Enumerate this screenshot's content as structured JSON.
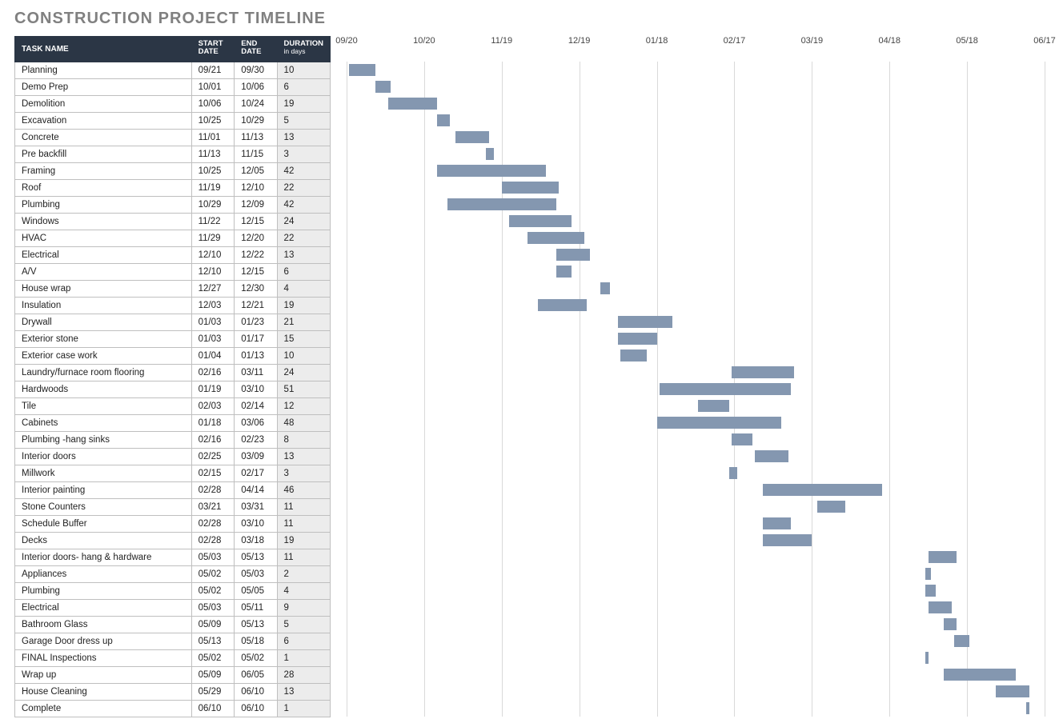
{
  "title": "CONSTRUCTION PROJECT TIMELINE",
  "columns": {
    "task": "TASK NAME",
    "start": "START DATE",
    "end": "END DATE",
    "duration": "DURATION",
    "duration_sub": "in days"
  },
  "timeline": {
    "start_day": 0,
    "end_day": 270,
    "ticks": [
      {
        "label": "09/20",
        "day": 0
      },
      {
        "label": "10/20",
        "day": 30
      },
      {
        "label": "11/19",
        "day": 60
      },
      {
        "label": "12/19",
        "day": 90
      },
      {
        "label": "01/18",
        "day": 120
      },
      {
        "label": "02/17",
        "day": 150
      },
      {
        "label": "03/19",
        "day": 180
      },
      {
        "label": "04/18",
        "day": 210
      },
      {
        "label": "05/18",
        "day": 240
      },
      {
        "label": "06/17",
        "day": 270
      }
    ]
  },
  "tasks": [
    {
      "name": "Planning",
      "start": "09/21",
      "end": "09/30",
      "duration": "10",
      "bar_start": 1,
      "bar_len": 10
    },
    {
      "name": "Demo Prep",
      "start": "10/01",
      "end": "10/06",
      "duration": "6",
      "bar_start": 11,
      "bar_len": 6
    },
    {
      "name": "Demolition",
      "start": "10/06",
      "end": "10/24",
      "duration": "19",
      "bar_start": 16,
      "bar_len": 19
    },
    {
      "name": "Excavation",
      "start": "10/25",
      "end": "10/29",
      "duration": "5",
      "bar_start": 35,
      "bar_len": 5
    },
    {
      "name": "Concrete",
      "start": "11/01",
      "end": "11/13",
      "duration": "13",
      "bar_start": 42,
      "bar_len": 13
    },
    {
      "name": "Pre backfill",
      "start": "11/13",
      "end": "11/15",
      "duration": "3",
      "bar_start": 54,
      "bar_len": 3
    },
    {
      "name": "Framing",
      "start": "10/25",
      "end": "12/05",
      "duration": "42",
      "bar_start": 35,
      "bar_len": 42
    },
    {
      "name": "Roof",
      "start": "11/19",
      "end": "12/10",
      "duration": "22",
      "bar_start": 60,
      "bar_len": 22
    },
    {
      "name": "Plumbing",
      "start": "10/29",
      "end": "12/09",
      "duration": "42",
      "bar_start": 39,
      "bar_len": 42
    },
    {
      "name": "Windows",
      "start": "11/22",
      "end": "12/15",
      "duration": "24",
      "bar_start": 63,
      "bar_len": 24
    },
    {
      "name": "HVAC",
      "start": "11/29",
      "end": "12/20",
      "duration": "22",
      "bar_start": 70,
      "bar_len": 22
    },
    {
      "name": "Electrical",
      "start": "12/10",
      "end": "12/22",
      "duration": "13",
      "bar_start": 81,
      "bar_len": 13
    },
    {
      "name": "A/V",
      "start": "12/10",
      "end": "12/15",
      "duration": "6",
      "bar_start": 81,
      "bar_len": 6
    },
    {
      "name": "House wrap",
      "start": "12/27",
      "end": "12/30",
      "duration": "4",
      "bar_start": 98,
      "bar_len": 4
    },
    {
      "name": "Insulation",
      "start": "12/03",
      "end": "12/21",
      "duration": "19",
      "bar_start": 74,
      "bar_len": 19
    },
    {
      "name": "Drywall",
      "start": "01/03",
      "end": "01/23",
      "duration": "21",
      "bar_start": 105,
      "bar_len": 21
    },
    {
      "name": "Exterior stone",
      "start": "01/03",
      "end": "01/17",
      "duration": "15",
      "bar_start": 105,
      "bar_len": 15
    },
    {
      "name": "Exterior case work",
      "start": "01/04",
      "end": "01/13",
      "duration": "10",
      "bar_start": 106,
      "bar_len": 10
    },
    {
      "name": "Laundry/furnace room flooring",
      "start": "02/16",
      "end": "03/11",
      "duration": "24",
      "bar_start": 149,
      "bar_len": 24
    },
    {
      "name": "Hardwoods",
      "start": "01/19",
      "end": "03/10",
      "duration": "51",
      "bar_start": 121,
      "bar_len": 51
    },
    {
      "name": "Tile",
      "start": "02/03",
      "end": "02/14",
      "duration": "12",
      "bar_start": 136,
      "bar_len": 12
    },
    {
      "name": "Cabinets",
      "start": "01/18",
      "end": "03/06",
      "duration": "48",
      "bar_start": 120,
      "bar_len": 48
    },
    {
      "name": "Plumbing -hang sinks",
      "start": "02/16",
      "end": "02/23",
      "duration": "8",
      "bar_start": 149,
      "bar_len": 8
    },
    {
      "name": "Interior doors",
      "start": "02/25",
      "end": "03/09",
      "duration": "13",
      "bar_start": 158,
      "bar_len": 13
    },
    {
      "name": "Millwork",
      "start": "02/15",
      "end": "02/17",
      "duration": "3",
      "bar_start": 148,
      "bar_len": 3
    },
    {
      "name": "Interior painting",
      "start": "02/28",
      "end": "04/14",
      "duration": "46",
      "bar_start": 161,
      "bar_len": 46
    },
    {
      "name": "Stone Counters",
      "start": "03/21",
      "end": "03/31",
      "duration": "11",
      "bar_start": 182,
      "bar_len": 11
    },
    {
      "name": "Schedule Buffer",
      "start": "02/28",
      "end": "03/10",
      "duration": "11",
      "bar_start": 161,
      "bar_len": 11
    },
    {
      "name": "Decks",
      "start": "02/28",
      "end": "03/18",
      "duration": "19",
      "bar_start": 161,
      "bar_len": 19
    },
    {
      "name": "Interior doors- hang & hardware",
      "start": "05/03",
      "end": "05/13",
      "duration": "11",
      "bar_start": 225,
      "bar_len": 11
    },
    {
      "name": "Appliances",
      "start": "05/02",
      "end": "05/03",
      "duration": "2",
      "bar_start": 224,
      "bar_len": 2
    },
    {
      "name": "Plumbing",
      "start": "05/02",
      "end": "05/05",
      "duration": "4",
      "bar_start": 224,
      "bar_len": 4
    },
    {
      "name": "Electrical",
      "start": "05/03",
      "end": "05/11",
      "duration": "9",
      "bar_start": 225,
      "bar_len": 9
    },
    {
      "name": "Bathroom Glass",
      "start": "05/09",
      "end": "05/13",
      "duration": "5",
      "bar_start": 231,
      "bar_len": 5
    },
    {
      "name": "Garage Door dress up",
      "start": "05/13",
      "end": "05/18",
      "duration": "6",
      "bar_start": 235,
      "bar_len": 6
    },
    {
      "name": "FINAL Inspections",
      "start": "05/02",
      "end": "05/02",
      "duration": "1",
      "bar_start": 224,
      "bar_len": 1
    },
    {
      "name": "Wrap up",
      "start": "05/09",
      "end": "06/05",
      "duration": "28",
      "bar_start": 231,
      "bar_len": 28
    },
    {
      "name": "House Cleaning",
      "start": "05/29",
      "end": "06/10",
      "duration": "13",
      "bar_start": 251,
      "bar_len": 13
    },
    {
      "name": "Complete",
      "start": "06/10",
      "end": "06/10",
      "duration": "1",
      "bar_start": 263,
      "bar_len": 1
    }
  ],
  "chart_data": {
    "type": "bar",
    "title": "CONSTRUCTION PROJECT TIMELINE",
    "xlabel": "",
    "ylabel": "",
    "x_axis_ticks": [
      "09/20",
      "10/20",
      "11/19",
      "12/19",
      "01/18",
      "02/17",
      "03/19",
      "04/18",
      "05/18",
      "06/17"
    ],
    "x_range_days": [
      0,
      270
    ],
    "series": [
      {
        "name": "Planning",
        "start_day": 1,
        "duration_days": 10
      },
      {
        "name": "Demo Prep",
        "start_day": 11,
        "duration_days": 6
      },
      {
        "name": "Demolition",
        "start_day": 16,
        "duration_days": 19
      },
      {
        "name": "Excavation",
        "start_day": 35,
        "duration_days": 5
      },
      {
        "name": "Concrete",
        "start_day": 42,
        "duration_days": 13
      },
      {
        "name": "Pre backfill",
        "start_day": 54,
        "duration_days": 3
      },
      {
        "name": "Framing",
        "start_day": 35,
        "duration_days": 42
      },
      {
        "name": "Roof",
        "start_day": 60,
        "duration_days": 22
      },
      {
        "name": "Plumbing",
        "start_day": 39,
        "duration_days": 42
      },
      {
        "name": "Windows",
        "start_day": 63,
        "duration_days": 24
      },
      {
        "name": "HVAC",
        "start_day": 70,
        "duration_days": 22
      },
      {
        "name": "Electrical",
        "start_day": 81,
        "duration_days": 13
      },
      {
        "name": "A/V",
        "start_day": 81,
        "duration_days": 6
      },
      {
        "name": "House wrap",
        "start_day": 98,
        "duration_days": 4
      },
      {
        "name": "Insulation",
        "start_day": 74,
        "duration_days": 19
      },
      {
        "name": "Drywall",
        "start_day": 105,
        "duration_days": 21
      },
      {
        "name": "Exterior stone",
        "start_day": 105,
        "duration_days": 15
      },
      {
        "name": "Exterior case work",
        "start_day": 106,
        "duration_days": 10
      },
      {
        "name": "Laundry/furnace room flooring",
        "start_day": 149,
        "duration_days": 24
      },
      {
        "name": "Hardwoods",
        "start_day": 121,
        "duration_days": 51
      },
      {
        "name": "Tile",
        "start_day": 136,
        "duration_days": 12
      },
      {
        "name": "Cabinets",
        "start_day": 120,
        "duration_days": 48
      },
      {
        "name": "Plumbing -hang sinks",
        "start_day": 149,
        "duration_days": 8
      },
      {
        "name": "Interior doors",
        "start_day": 158,
        "duration_days": 13
      },
      {
        "name": "Millwork",
        "start_day": 148,
        "duration_days": 3
      },
      {
        "name": "Interior painting",
        "start_day": 161,
        "duration_days": 46
      },
      {
        "name": "Stone Counters",
        "start_day": 182,
        "duration_days": 11
      },
      {
        "name": "Schedule Buffer",
        "start_day": 161,
        "duration_days": 11
      },
      {
        "name": "Decks",
        "start_day": 161,
        "duration_days": 19
      },
      {
        "name": "Interior doors- hang & hardware",
        "start_day": 225,
        "duration_days": 11
      },
      {
        "name": "Appliances",
        "start_day": 224,
        "duration_days": 2
      },
      {
        "name": "Plumbing",
        "start_day": 224,
        "duration_days": 4
      },
      {
        "name": "Electrical",
        "start_day": 225,
        "duration_days": 9
      },
      {
        "name": "Bathroom Glass",
        "start_day": 231,
        "duration_days": 5
      },
      {
        "name": "Garage Door dress up",
        "start_day": 235,
        "duration_days": 6
      },
      {
        "name": "FINAL Inspections",
        "start_day": 224,
        "duration_days": 1
      },
      {
        "name": "Wrap up",
        "start_day": 231,
        "duration_days": 28
      },
      {
        "name": "House Cleaning",
        "start_day": 251,
        "duration_days": 13
      },
      {
        "name": "Complete",
        "start_day": 263,
        "duration_days": 1
      }
    ]
  }
}
